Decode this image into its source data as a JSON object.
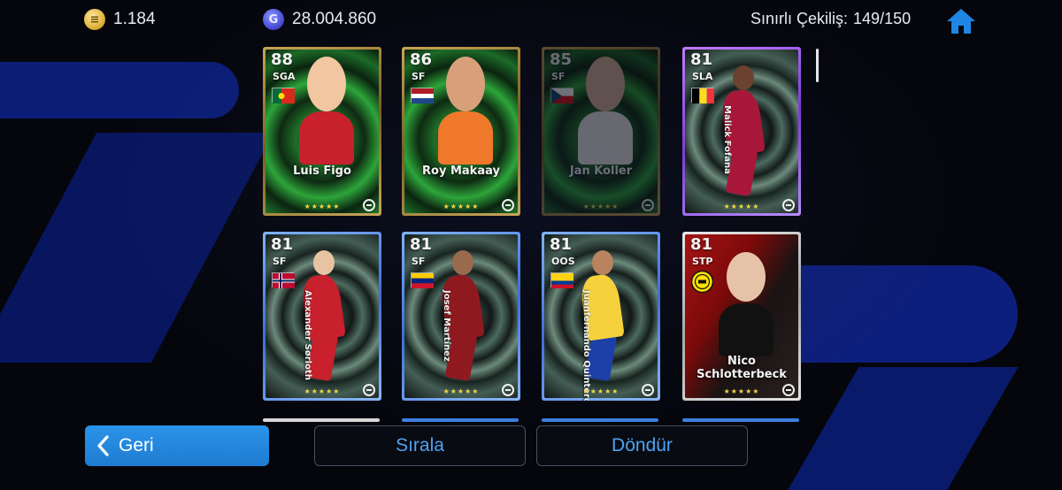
{
  "topbar": {
    "coins_value": "1.184",
    "gp_value": "28.004.860",
    "limited_label": "Sınırlı Çekiliş:",
    "limited_value": "149/150",
    "coin_icon": "coin-icon",
    "gp_icon": "gp-icon",
    "home_icon": "home-icon"
  },
  "cards": [
    {
      "rating": "88",
      "position": "SGA",
      "name": "Luis Figo",
      "frame": "gold",
      "flag": "portugal",
      "dimmed": false
    },
    {
      "rating": "86",
      "position": "SF",
      "name": "Roy Makaay",
      "frame": "gold",
      "flag": "netherlands",
      "dimmed": false
    },
    {
      "rating": "85",
      "position": "SF",
      "name": "Jan Koller",
      "frame": "gold",
      "flag": "czechia",
      "dimmed": true
    },
    {
      "rating": "81",
      "position": "SLA",
      "name": "Malick Fofana",
      "frame": "purple",
      "flag": "belgium",
      "dimmed": false
    },
    {
      "rating": "81",
      "position": "SF",
      "name": "Alexander Sørloth",
      "frame": "silverblue",
      "flag": "norway",
      "dimmed": false
    },
    {
      "rating": "81",
      "position": "SF",
      "name": "Josef Martínez",
      "frame": "silverblue",
      "flag": "venezuela",
      "dimmed": false
    },
    {
      "rating": "81",
      "position": "OOS",
      "name": "Juanfernando Quintero",
      "frame": "silverblue",
      "flag": "colombia",
      "dimmed": false
    },
    {
      "rating": "81",
      "position": "STP",
      "name": "Nico Schlotterbeck",
      "frame": "white",
      "flag": "bvb",
      "dimmed": false
    }
  ],
  "stars": "★★★★★",
  "buttons": {
    "back_label": "Geri",
    "sort_label": "Sırala",
    "flip_label": "Döndür"
  },
  "colors": {
    "accent_blue": "#2a8ce6",
    "text_blue": "#4da3f2",
    "star_gold": "#f2d748"
  }
}
